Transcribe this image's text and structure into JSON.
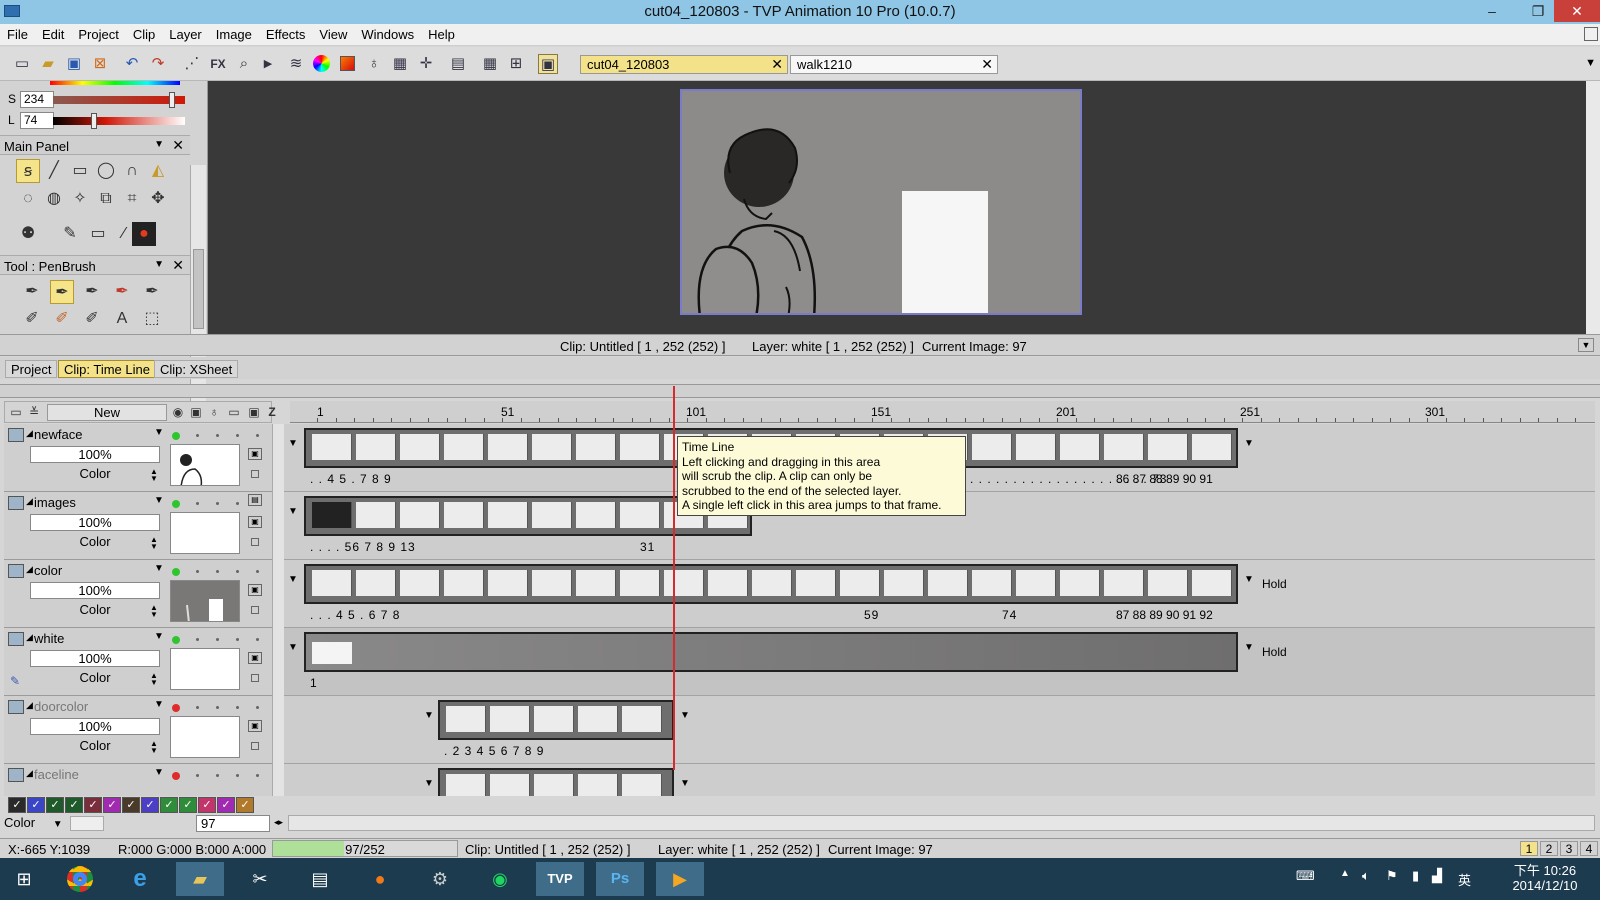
{
  "window": {
    "title": "cut04_120803 - TVP Animation 10 Pro (10.0.7)",
    "minimize": "–",
    "maximize": "❐",
    "close": "✕"
  },
  "menu": [
    "File",
    "Edit",
    "Project",
    "Clip",
    "Layer",
    "Image",
    "Effects",
    "View",
    "Windows",
    "Help"
  ],
  "toolbar": {
    "icons": [
      "new-doc-icon",
      "open-icon",
      "save-icon",
      "close-doc-icon",
      "undo-icon",
      "redo-icon",
      "warp-icon",
      "fx-icon",
      "zoom-icon",
      "play-icon",
      "layers-icon",
      "color-wheel-icon",
      "color-square-icon",
      "bulb-icon",
      "grid-box-icon",
      "crosshair-icon",
      "film-icon",
      "grid-icon",
      "grid2-icon",
      "display-icon"
    ],
    "fx_label": "FX",
    "doc_tabs": [
      {
        "label": "cut04_120803",
        "active": true
      },
      {
        "label": "walk1210",
        "active": false
      }
    ]
  },
  "color_sliders": {
    "s_label": "S",
    "s_value": "234",
    "l_label": "L",
    "l_value": "74"
  },
  "main_panel": {
    "title": "Main Panel"
  },
  "tool_panel": {
    "title": "Tool : PenBrush"
  },
  "status_top": {
    "clip": "Clip: Untitled [ 1 , 252  (252) ]",
    "layer": "Layer: white [ 1 , 252  (252) ]",
    "current": "Current Image: 97"
  },
  "panel_tabs": [
    {
      "label": "Project",
      "active": false
    },
    {
      "label": "Clip: Time Line",
      "active": true
    },
    {
      "label": "Clip: XSheet",
      "active": false
    }
  ],
  "timeline": {
    "new_button": "New",
    "z_label": "Z",
    "ruler": [
      "1",
      "51",
      "101",
      "151",
      "201",
      "251",
      "301"
    ],
    "current_frame": 97,
    "total_frames": 252,
    "layers": [
      {
        "name": "newface",
        "opacity": "100%",
        "mode": "Color",
        "light": "green",
        "dim": false
      },
      {
        "name": "images",
        "opacity": "100%",
        "mode": "Color",
        "light": "green",
        "dim": false
      },
      {
        "name": "color",
        "opacity": "100%",
        "mode": "Color",
        "light": "green",
        "dim": false
      },
      {
        "name": "white",
        "opacity": "100%",
        "mode": "Color",
        "light": "green",
        "dim": false
      },
      {
        "name": "doorcolor",
        "opacity": "100%",
        "mode": "Color",
        "light": "red",
        "dim": true
      },
      {
        "name": "faceline",
        "opacity": "",
        "mode": "",
        "light": "red",
        "dim": true
      }
    ],
    "track_labels": [
      {
        "left": ". . 4 5 . 7 8 9",
        "mid": ". . . . . . . . . . . . . . . . . . . . . . . . 73",
        "right": "86 87  88 89  90   91"
      },
      {
        "left": ". . . . 56   7 8 9      13",
        "mid": "31",
        "right": ""
      },
      {
        "left": ". . . 4 5 .  6 7 8",
        "mid": "59",
        "mid2": "74",
        "right": "87 88   89 90  91    92"
      },
      {
        "left": "1",
        "mid": "",
        "right": ""
      },
      {
        "left": ". 2 3 4  5 6 7 8 9",
        "mid": "",
        "right": ""
      }
    ],
    "hold_label": "Hold",
    "tooltip": {
      "title": "Time Line",
      "lines": [
        "Left clicking and dragging in this area",
        "will scrub the clip. A clip can only be",
        "scrubbed to the end of the selected layer.",
        "A single left click in this area jumps to that frame."
      ]
    }
  },
  "bottom_controls": {
    "color_mode": "Color",
    "frame_value": "97",
    "swatches": [
      "#2a2a2a",
      "#3a46c6",
      "#1f5a2b",
      "#1f5a2b",
      "#7a2d3b",
      "#a12bb0",
      "#4a3a2a",
      "#4d3ec6",
      "#2f8c3a",
      "#2f8c3a",
      "#c1356b",
      "#a12bb0",
      "#b07a2a"
    ]
  },
  "statusbar": {
    "coords": "X:-665  Y:1039",
    "rgba": "R:000 G:000 B:000 A:000",
    "progress_text": "97/252",
    "progress_fraction": 0.385,
    "clip": "Clip: Untitled [ 1 , 252  (252) ]",
    "layer": "Layer: white [ 1 , 252  (252) ]",
    "current": "Current Image: 97",
    "pages": [
      "1",
      "2",
      "3",
      "4"
    ]
  },
  "taskbar": {
    "apps": [
      "windows-start-icon",
      "chrome-icon",
      "ie-icon",
      "explorer-icon",
      "paint-icon",
      "calculator-icon",
      "firefox-icon",
      "settings-app-icon",
      "spotify-icon",
      "tvp-icon",
      "photoshop-icon",
      "media-icon"
    ],
    "tvp_label": "TVP",
    "ps_label": "Ps",
    "ime": "英",
    "time": "下午 10:26",
    "date": "2014/12/10"
  }
}
